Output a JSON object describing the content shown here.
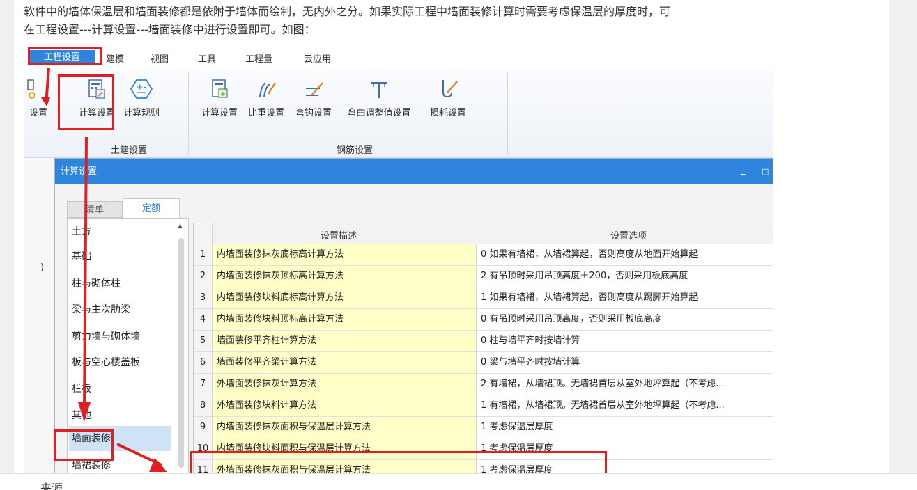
{
  "article": {
    "intro_line1": "软件中的墙体保温层和墙面装修都是依附于墙体而绘制，无内外之分。如果实际工程中墙面装修计算时需要考虑保温层的厚度时，可",
    "intro_line2": "在工程设置---计算设置---墙面装修中进行设置即可。如图：",
    "bottom_text": "来源"
  },
  "menubar": {
    "items": [
      "工程设置",
      "建模",
      "视图",
      "工具",
      "工程量",
      "云应用"
    ]
  },
  "ribbon": {
    "left_cut_label": "设置",
    "buttons": [
      {
        "label": "计算设置",
        "icon": "calc-settings-icon"
      },
      {
        "label": "计算规则",
        "icon": "calc-rules-icon"
      },
      {
        "label": "计算设置",
        "icon": "rebar-calc-settings-icon"
      },
      {
        "label": "比重设置",
        "icon": "density-settings-icon"
      },
      {
        "label": "弯钩设置",
        "icon": "hook-settings-icon"
      },
      {
        "label": "弯曲调整值设置",
        "icon": "bend-adjust-icon"
      },
      {
        "label": "损耗设置",
        "icon": "loss-settings-icon"
      }
    ],
    "groups": [
      "土建设置",
      "钢筋设置"
    ]
  },
  "dialog": {
    "title": "计算设置",
    "minimize": "_",
    "maximize": "□",
    "tabs": [
      "清单",
      "定额"
    ],
    "side_cut_label": ")",
    "categories": [
      "土方",
      "基础",
      "柱与砌体柱",
      "梁与主次肋梁",
      "剪力墙与砌体墙",
      "板与空心楼盖板",
      "栏板",
      "其他",
      "墙面装修",
      "墙裙装修"
    ],
    "selected_category": "墙面装修",
    "grid": {
      "col_desc": "设置描述",
      "col_option": "设置选项",
      "rows": [
        {
          "n": "1",
          "desc": "内墙面装修抹灰底标高计算方法",
          "opt": "0 如果有墙裙，从墙裙算起，否则高度从地面开始算起"
        },
        {
          "n": "2",
          "desc": "内墙面装修抹灰顶标高计算方法",
          "opt": "2 有吊顶时采用吊顶高度＋200，否则采用板底高度"
        },
        {
          "n": "3",
          "desc": "内墙面装修块料底标高计算方法",
          "opt": "1 如果有墙裙，从墙裙算起，否则高度从踢脚开始算起"
        },
        {
          "n": "4",
          "desc": "内墙面装修块料顶标高计算方法",
          "opt": "0 有吊顶时采用吊顶高度，否则采用板底高度"
        },
        {
          "n": "5",
          "desc": "墙面装修平齐柱计算方法",
          "opt": "0 柱与墙平齐时按墙计算"
        },
        {
          "n": "6",
          "desc": "墙面装修平齐梁计算方法",
          "opt": "0 梁与墙平齐时按墙计算"
        },
        {
          "n": "7",
          "desc": "外墙面装修抹灰计算方法",
          "opt": "2 有墙裙，从墙裙顶。无墙裙首层从室外地坪算起（不考虑..."
        },
        {
          "n": "8",
          "desc": "外墙面装修块料计算方法",
          "opt": "1 有墙裙，从墙裙顶。无墙裙首层从室外地坪算起（不考虑..."
        },
        {
          "n": "9",
          "desc": "内墙面装修抹灰面积与保温层计算方法",
          "opt": "1 考虑保温层厚度"
        },
        {
          "n": "10",
          "desc": "内墙面装修块料面积与保温层计算方法",
          "opt": "1 考虑保温层厚度"
        },
        {
          "n": "11",
          "desc": "外墙面装修抹灰面积与保温层计算方法",
          "opt": "1 考虑保温层厚度"
        }
      ]
    }
  },
  "colors": {
    "accent": "#2f84de",
    "annotation_red": "#e02020",
    "desc_cell_bg": "#ffffc8"
  }
}
